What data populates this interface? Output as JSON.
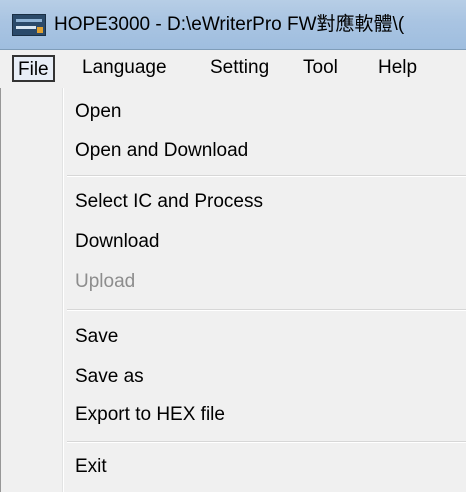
{
  "window": {
    "title": "HOPE3000  -  D:\\eWriterPro FW對應軟體\\(",
    "icon": "app-chip-icon"
  },
  "menubar": {
    "items": [
      {
        "label": "File"
      },
      {
        "label": "Language"
      },
      {
        "label": "Setting"
      },
      {
        "label": "Tool"
      },
      {
        "label": "Help"
      }
    ]
  },
  "file_menu": {
    "items": [
      {
        "label": "Open",
        "enabled": true
      },
      {
        "label": "Open and Download",
        "enabled": true
      },
      {
        "label": "Select IC and Process",
        "enabled": true
      },
      {
        "label": "Download",
        "enabled": true
      },
      {
        "label": "Upload",
        "enabled": false
      },
      {
        "label": "Save",
        "enabled": true
      },
      {
        "label": "Save as",
        "enabled": true
      },
      {
        "label": "Export to HEX file",
        "enabled": true
      },
      {
        "label": "Exit",
        "enabled": true
      }
    ]
  },
  "colors": {
    "titlebar": "#a9c4e2",
    "menu_background": "#f0f0f0",
    "disabled_text": "#8d8d8d"
  }
}
